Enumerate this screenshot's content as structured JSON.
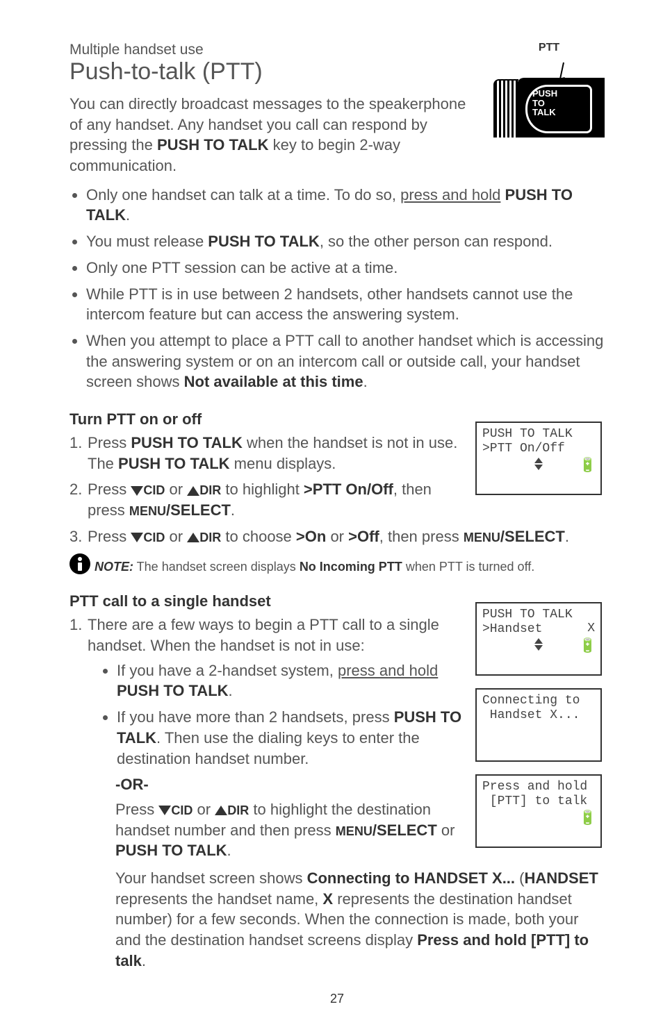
{
  "breadcrumb": "Multiple handset use",
  "title": "Push-to-talk (PTT)",
  "ptt_fig": {
    "label": "PTT",
    "button_text_l1": "PUSH",
    "button_text_l2": "TO",
    "button_text_l3": "TALK"
  },
  "intro_parts": {
    "p1": "You can directly broadcast messages to the speakerphone of any handset. Any handset you call can respond by pressing the ",
    "p2": "PUSH TO TALK",
    "p3": " key to begin 2-way communication."
  },
  "bullets": [
    {
      "pre": "Only one handset can talk at a time. To do so, ",
      "u": "press and hold",
      "post": " ",
      "bold": "PUSH TO TALK",
      "tail": "."
    },
    {
      "pre": "You must release ",
      "bold": "PUSH TO TALK",
      "post": ", so the other person can respond."
    },
    {
      "pre": "Only one PTT session can be active at a time."
    },
    {
      "pre": "While PTT is in use between 2 handsets, other handsets cannot use the intercom feature but can access the answering system."
    },
    {
      "pre": "When you attempt to place a PTT call to another handset which is accessing the answering system or on an intercom call or outside call, your handset screen shows ",
      "bold": "Not available at this time",
      "post": "."
    }
  ],
  "section1_title": "Turn PTT on or off",
  "section1_steps": [
    {
      "segs": [
        {
          "t": "Press "
        },
        {
          "b": "PUSH TO TALK"
        },
        {
          "t": " when the handset is not in use. The "
        },
        {
          "b": "PUSH TO TALK"
        },
        {
          "t": " menu displays."
        }
      ]
    },
    {
      "segs": [
        {
          "t": "Press "
        },
        {
          "ad": "down"
        },
        {
          "sc": "CID"
        },
        {
          "t": " or "
        },
        {
          "ad": "up"
        },
        {
          "sc": "DIR"
        },
        {
          "t": " to highlight "
        },
        {
          "b": ">PTT On/Off"
        },
        {
          "t": ", then press "
        },
        {
          "sc": "MENU"
        },
        {
          "b": "/SELECT"
        },
        {
          "t": "."
        }
      ]
    },
    {
      "segs": [
        {
          "t": "Press "
        },
        {
          "ad": "down"
        },
        {
          "sc": "CID"
        },
        {
          "t": " or "
        },
        {
          "ad": "up"
        },
        {
          "sc": "DIR"
        },
        {
          "t": " to choose "
        },
        {
          "b": ">On"
        },
        {
          "t": " or "
        },
        {
          "b": ">Off"
        },
        {
          "t": ", then press "
        },
        {
          "sc": "MENU"
        },
        {
          "b": "/SELECT"
        },
        {
          "t": "."
        }
      ]
    }
  ],
  "note": {
    "label": "NOTE:",
    "pre": " The handset screen displays ",
    "bold": "No Incoming PTT",
    "post": " when PTT is turned off."
  },
  "section2_title": "PTT call to a single handset",
  "section2_step1_lead": "There are a few ways to begin a PTT call to a single handset. When the handset is not in use:",
  "section2_sub": [
    {
      "segs": [
        {
          "t": "If you have a 2-handset system, "
        },
        {
          "u": "press and hold"
        },
        {
          "t": " "
        },
        {
          "b": "PUSH TO TALK"
        },
        {
          "t": "."
        }
      ]
    },
    {
      "segs": [
        {
          "t": "If you have more than 2 handsets, press "
        },
        {
          "b": "PUSH TO TALK"
        },
        {
          "t": ". Then use the dialing keys to enter the destination handset number."
        }
      ]
    }
  ],
  "or_label": "-OR-",
  "section2_or_para": {
    "segs": [
      {
        "t": "Press "
      },
      {
        "ad": "down"
      },
      {
        "sc": "CID"
      },
      {
        "t": " or "
      },
      {
        "ad": "up"
      },
      {
        "sc": "DIR"
      },
      {
        "t": " to highlight the destination handset number and then press "
      },
      {
        "sc": "MENU"
      },
      {
        "b": "/SELECT"
      },
      {
        "t": " or "
      },
      {
        "b": "PUSH TO TALK"
      },
      {
        "t": "."
      }
    ]
  },
  "section2_para2": {
    "segs": [
      {
        "t": "Your handset screen shows "
      },
      {
        "b": "Connecting to HANDSET X..."
      },
      {
        "t": " ("
      },
      {
        "b": "HANDSET"
      },
      {
        "t": " represents the handset name, "
      },
      {
        "b": "X"
      },
      {
        "t": " represents the destination handset number) for a few seconds. When the connection is made, both your and the destination handset screens display "
      },
      {
        "b": "Press and hold [PTT] to talk"
      },
      {
        "t": "."
      }
    ]
  },
  "lcd1": {
    "l1": "PUSH TO TALK",
    "l2": ">PTT On/Off"
  },
  "lcd2": {
    "l1": "PUSH TO TALK",
    "l2": ">Handset",
    "rx": "X"
  },
  "lcd3": {
    "l1": "Connecting to",
    "l2": " Handset X..."
  },
  "lcd4": {
    "l1": "Press and hold",
    "l2": " [PTT] to talk"
  },
  "page_number": "27"
}
